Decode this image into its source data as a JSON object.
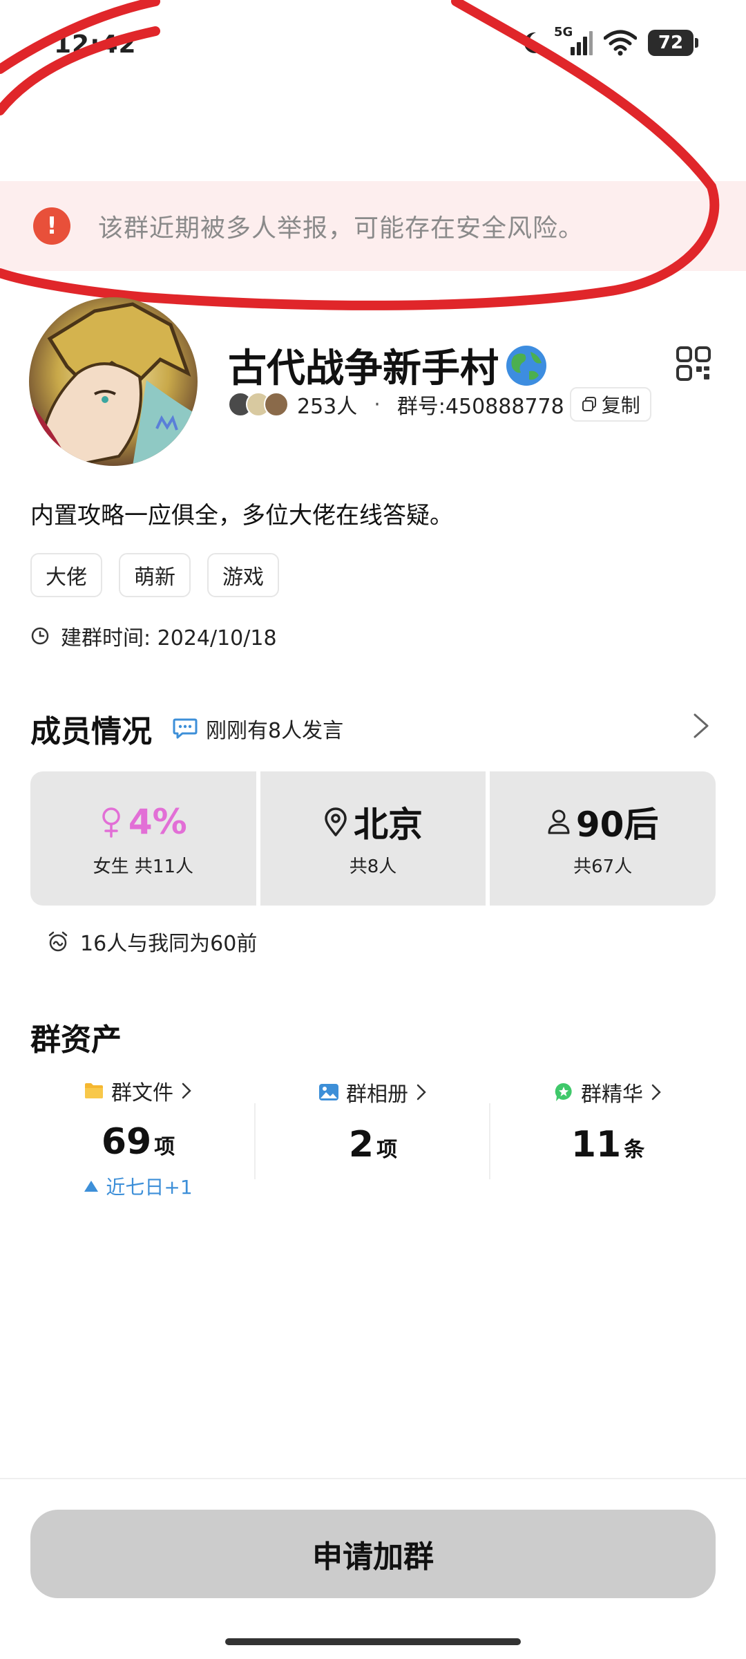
{
  "status_bar": {
    "time": "12:42",
    "network": "5G",
    "battery": "72"
  },
  "warning": {
    "icon": "!",
    "text": "该群近期被多人举报，可能存在安全风险。"
  },
  "group": {
    "name": "古代战争新手村",
    "member_count": "253人",
    "separator": "·",
    "group_id": "群号:450888778",
    "copy_label": "复制",
    "description": "内置攻略一应俱全，多位大佬在线答疑。",
    "tags": [
      "大佬",
      "萌新",
      "游戏"
    ],
    "created": "建群时间: 2024/10/18"
  },
  "members": {
    "title": "成员情况",
    "recent": "刚刚有8人发言",
    "stats": [
      {
        "value": "4%",
        "sub": "女生 共11人",
        "icon": "female-icon"
      },
      {
        "value": "北京",
        "sub": "共8人",
        "icon": "location-pin-icon"
      },
      {
        "value": "90后",
        "sub": "共67人",
        "icon": "person-icon"
      }
    ],
    "same_age": "16人与我同为60前"
  },
  "assets": {
    "title": "群资产",
    "items": [
      {
        "label": "群文件",
        "num": "69",
        "unit": "项",
        "trend": "近七日+1",
        "icon": "folder-icon"
      },
      {
        "label": "群相册",
        "num": "2",
        "unit": "项",
        "icon": "photo-album-icon"
      },
      {
        "label": "群精华",
        "num": "11",
        "unit": "条",
        "icon": "star-badge-icon"
      }
    ]
  },
  "join_button": "申请加群",
  "colors": {
    "warning_bg": "#fdeeee",
    "warning_icon": "#e8503a",
    "female_pink": "#e26fd6",
    "trend_blue": "#3d8fd8",
    "card_bg": "#e7e7e7",
    "button_bg": "#cccccc",
    "scribble_red": "#e0262a"
  }
}
